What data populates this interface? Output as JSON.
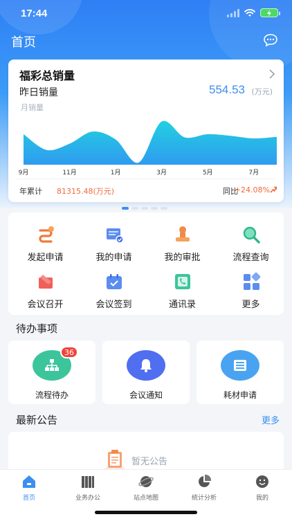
{
  "status_bar": {
    "time": "17:44"
  },
  "header": {
    "title": "首页"
  },
  "sales_card": {
    "title": "福彩总销量",
    "yesterday_label": "昨日销量",
    "yesterday_value": "554.53",
    "yesterday_unit": "(万元)",
    "chart_legend": "月销量",
    "accumulated_label": "年累计",
    "accumulated_value": "81315.48(万元)",
    "yoy_label": "同比",
    "yoy_value": "+24.08%"
  },
  "chart_data": {
    "type": "area",
    "series_label": "月销量",
    "x_tick_labels": [
      "9月",
      "11月",
      "1月",
      "3月",
      "5月",
      "7月"
    ],
    "x": [
      "9月",
      "10月",
      "11月",
      "12月",
      "1月",
      "2月",
      "3月",
      "4月",
      "5月",
      "6月",
      "7月",
      "8月"
    ],
    "values": [
      58,
      28,
      40,
      63,
      48,
      4,
      82,
      52,
      58,
      55,
      50,
      53
    ],
    "ylim": [
      0,
      100
    ],
    "fill_color_top": "#22d0e0",
    "fill_color_bottom": "#2f9bf0"
  },
  "carousel": {
    "count": 5,
    "active": 0
  },
  "grid_menu": [
    {
      "label": "发起申请",
      "icon": "initiate-application-icon"
    },
    {
      "label": "我的申请",
      "icon": "my-application-icon"
    },
    {
      "label": "我的审批",
      "icon": "my-approval-icon"
    },
    {
      "label": "流程查询",
      "icon": "process-search-icon"
    },
    {
      "label": "会议召开",
      "icon": "meeting-convene-icon"
    },
    {
      "label": "会议签到",
      "icon": "meeting-checkin-icon"
    },
    {
      "label": "通讯录",
      "icon": "contacts-icon"
    },
    {
      "label": "更多",
      "icon": "more-grid-icon"
    }
  ],
  "todo_section": {
    "title": "待办事项",
    "items": [
      {
        "label": "流程待办",
        "badge": "36",
        "color": "#3cc59a"
      },
      {
        "label": "会议通知",
        "color": "#4f6ff0"
      },
      {
        "label": "耗材申请",
        "color": "#4aa3f0"
      }
    ]
  },
  "notice_section": {
    "title": "最新公告",
    "more": "更多",
    "empty_text": "暂无公告"
  },
  "tabbar": [
    {
      "label": "首页",
      "active": true
    },
    {
      "label": "业务办公"
    },
    {
      "label": "站点地图"
    },
    {
      "label": "统计分析"
    },
    {
      "label": "我的"
    }
  ],
  "colors": {
    "accent": "#3d8ef0",
    "highlight": "#f06a3a",
    "badge": "#f0453a"
  }
}
